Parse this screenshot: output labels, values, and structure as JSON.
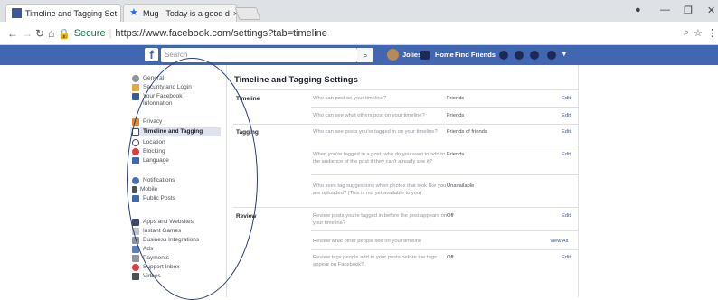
{
  "browser": {
    "tabs": [
      {
        "title": "Timeline and Tagging Set",
        "close": "×"
      },
      {
        "title": "Mug - Today is a good d",
        "close": "×"
      }
    ],
    "secure_label": "Secure",
    "url": "https://www.facebook.com/settings?tab=timeline"
  },
  "fb": {
    "search_placeholder": "Search",
    "user_name": "Joliest",
    "home": "Home",
    "find_friends": "Find Friends"
  },
  "sidebar": {
    "items": [
      {
        "label": "General"
      },
      {
        "label": "Security and Login"
      },
      {
        "label": "Your Facebook Information"
      },
      {
        "label": "Privacy"
      },
      {
        "label": "Timeline and Tagging"
      },
      {
        "label": "Location"
      },
      {
        "label": "Blocking"
      },
      {
        "label": "Language"
      },
      {
        "label": "Notifications"
      },
      {
        "label": "Mobile"
      },
      {
        "label": "Public Posts"
      },
      {
        "label": "Apps and Websites"
      },
      {
        "label": "Instant Games"
      },
      {
        "label": "Business Integrations"
      },
      {
        "label": "Ads"
      },
      {
        "label": "Payments"
      },
      {
        "label": "Support Inbox"
      },
      {
        "label": "Videos"
      }
    ]
  },
  "main": {
    "title": "Timeline and Tagging Settings",
    "sections": [
      {
        "name": "Timeline"
      },
      {
        "name": "Tagging"
      },
      {
        "name": "Review"
      }
    ],
    "rows": [
      {
        "q": "Who can post on your timeline?",
        "v": "Friends",
        "a": "Edit"
      },
      {
        "q": "Who can see what others post on your timeline?",
        "v": "Friends",
        "a": "Edit"
      },
      {
        "q": "Who can see posts you're tagged in on your timeline?",
        "v": "Friends of friends",
        "a": "Edit"
      },
      {
        "q": "When you're tagged in a post, who do you want to add to the audience of the post if they can't already see it?",
        "v": "Friends",
        "a": "Edit"
      },
      {
        "q": "Who sees tag suggestions when photos that look like you are uploaded? (This is not yet available to you)",
        "v": "Unavailable",
        "a": ""
      },
      {
        "q": "Review posts you're tagged in before the post appears on your timeline?",
        "v": "Off",
        "a": "Edit"
      },
      {
        "q": "Review what other people see on your timeline",
        "v": "",
        "a": "View As"
      },
      {
        "q": "Review tags people add to your posts before the tags appear on Facebook?",
        "v": "Off",
        "a": "Edit"
      }
    ]
  }
}
